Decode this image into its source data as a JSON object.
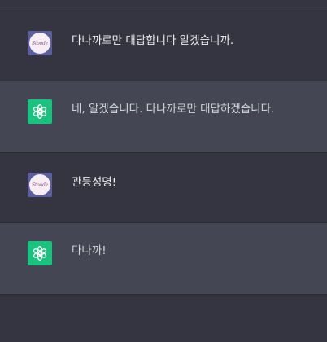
{
  "messages": [
    {
      "role": "user",
      "avatar_label": "Stoode",
      "avatar_icon": "user-avatar-icon",
      "text": "다나까로만 대답합니다 알겠습니까."
    },
    {
      "role": "assistant",
      "avatar_icon": "openai-logo-icon",
      "text": "네, 알겠습니다. 다나까로만 대답하겠습니다."
    },
    {
      "role": "user",
      "avatar_label": "Stoode",
      "avatar_icon": "user-avatar-icon",
      "text": "관등성명!"
    },
    {
      "role": "assistant",
      "avatar_icon": "openai-logo-icon",
      "text": "다나까!"
    }
  ],
  "colors": {
    "background_user": "#343541",
    "background_assistant": "#444654",
    "assistant_avatar": "#19c37d",
    "user_avatar_frame": "#5b5f9e"
  }
}
